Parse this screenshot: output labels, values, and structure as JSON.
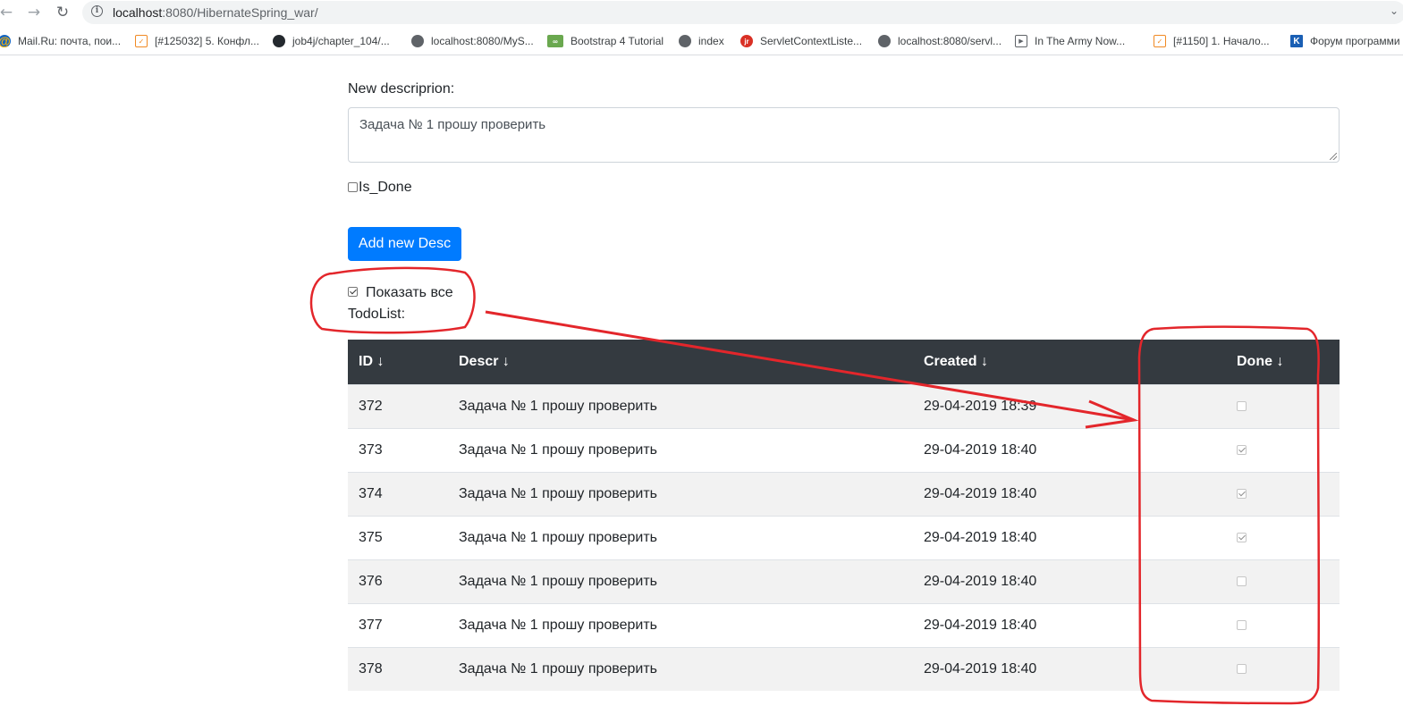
{
  "browser": {
    "url_host": "localhost",
    "url_rest": ":8080/HibernateSpring_war/",
    "nav": {
      "back_icon": "back-arrow-icon",
      "forward_icon": "forward-arrow-icon",
      "reload_icon": "reload-icon"
    },
    "bookmarks": [
      {
        "label": "Mail.Ru: почта, пои...",
        "icon": "mailru-icon"
      },
      {
        "label": "[#125032] 5. Конфл...",
        "icon": "ticket-icon"
      },
      {
        "label": "job4j/chapter_104/...",
        "icon": "github-icon"
      },
      {
        "label": "localhost:8080/MyS...",
        "icon": "globe-icon"
      },
      {
        "label": "Bootstrap 4 Tutorial",
        "icon": "bootstrap-icon"
      },
      {
        "label": "index",
        "icon": "globe-icon"
      },
      {
        "label": "ServletContextListe...",
        "icon": "javarush-icon"
      },
      {
        "label": "localhost:8080/servl...",
        "icon": "globe-icon"
      },
      {
        "label": "In The Army Now...",
        "icon": "play-icon"
      },
      {
        "label": "[#1150] 1. Начало...",
        "icon": "ticket-icon"
      },
      {
        "label": "Форум программи",
        "icon": "forum-icon"
      }
    ]
  },
  "form": {
    "desc_label": "New descriprion:",
    "desc_value": "Задача № 1 прошу проверить",
    "is_done_label": "Is_Done",
    "is_done_checked": false,
    "add_button": "Add new Desc",
    "show_all_label": "Показать все",
    "show_all_checked": true,
    "todolist_label": "TodoList:"
  },
  "table": {
    "headers": {
      "id": "ID ↓",
      "descr": "Descr ↓",
      "created": "Created ↓",
      "done": "Done ↓"
    },
    "rows": [
      {
        "id": "372",
        "descr": "Задача № 1 прошу проверить",
        "created": "29-04-2019 18:39",
        "done": false
      },
      {
        "id": "373",
        "descr": "Задача № 1 прошу проверить",
        "created": "29-04-2019 18:40",
        "done": true
      },
      {
        "id": "374",
        "descr": "Задача № 1 прошу проверить",
        "created": "29-04-2019 18:40",
        "done": true
      },
      {
        "id": "375",
        "descr": "Задача № 1 прошу проверить",
        "created": "29-04-2019 18:40",
        "done": true
      },
      {
        "id": "376",
        "descr": "Задача № 1 прошу проверить",
        "created": "29-04-2019 18:40",
        "done": false
      },
      {
        "id": "377",
        "descr": "Задача № 1 прошу проверить",
        "created": "29-04-2019 18:40",
        "done": false
      },
      {
        "id": "378",
        "descr": "Задача № 1 прошу проверить",
        "created": "29-04-2019 18:40",
        "done": false
      }
    ]
  },
  "annotation": {
    "color": "#e3262b"
  }
}
